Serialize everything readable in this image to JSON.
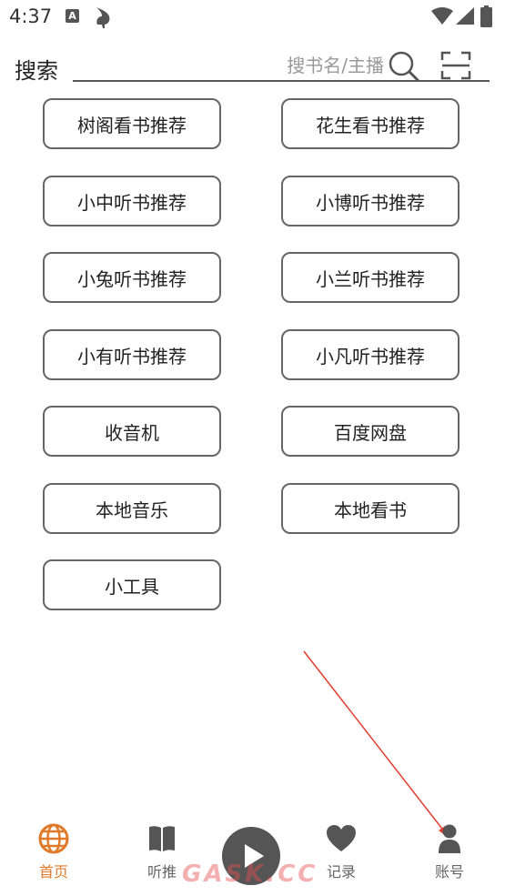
{
  "status": {
    "time": "4:37",
    "a_badge": "A"
  },
  "search": {
    "label": "搜索",
    "placeholder": "搜书名/主播"
  },
  "menu": [
    "树阁看书推荐",
    "花生看书推荐",
    "小中听书推荐",
    "小博听书推荐",
    "小兔听书推荐",
    "小兰听书推荐",
    "小有听书推荐",
    "小凡听书推荐",
    "收音机",
    "百度网盘",
    "本地音乐",
    "本地看书",
    "小工具"
  ],
  "nav": {
    "home": "首页",
    "listen": "听推",
    "records": "记录",
    "account": "账号"
  },
  "watermark": "GASK.CC",
  "colors": {
    "accent": "#e07a2a",
    "annotation_arrow": "#e23c2c",
    "border": "#666666"
  }
}
